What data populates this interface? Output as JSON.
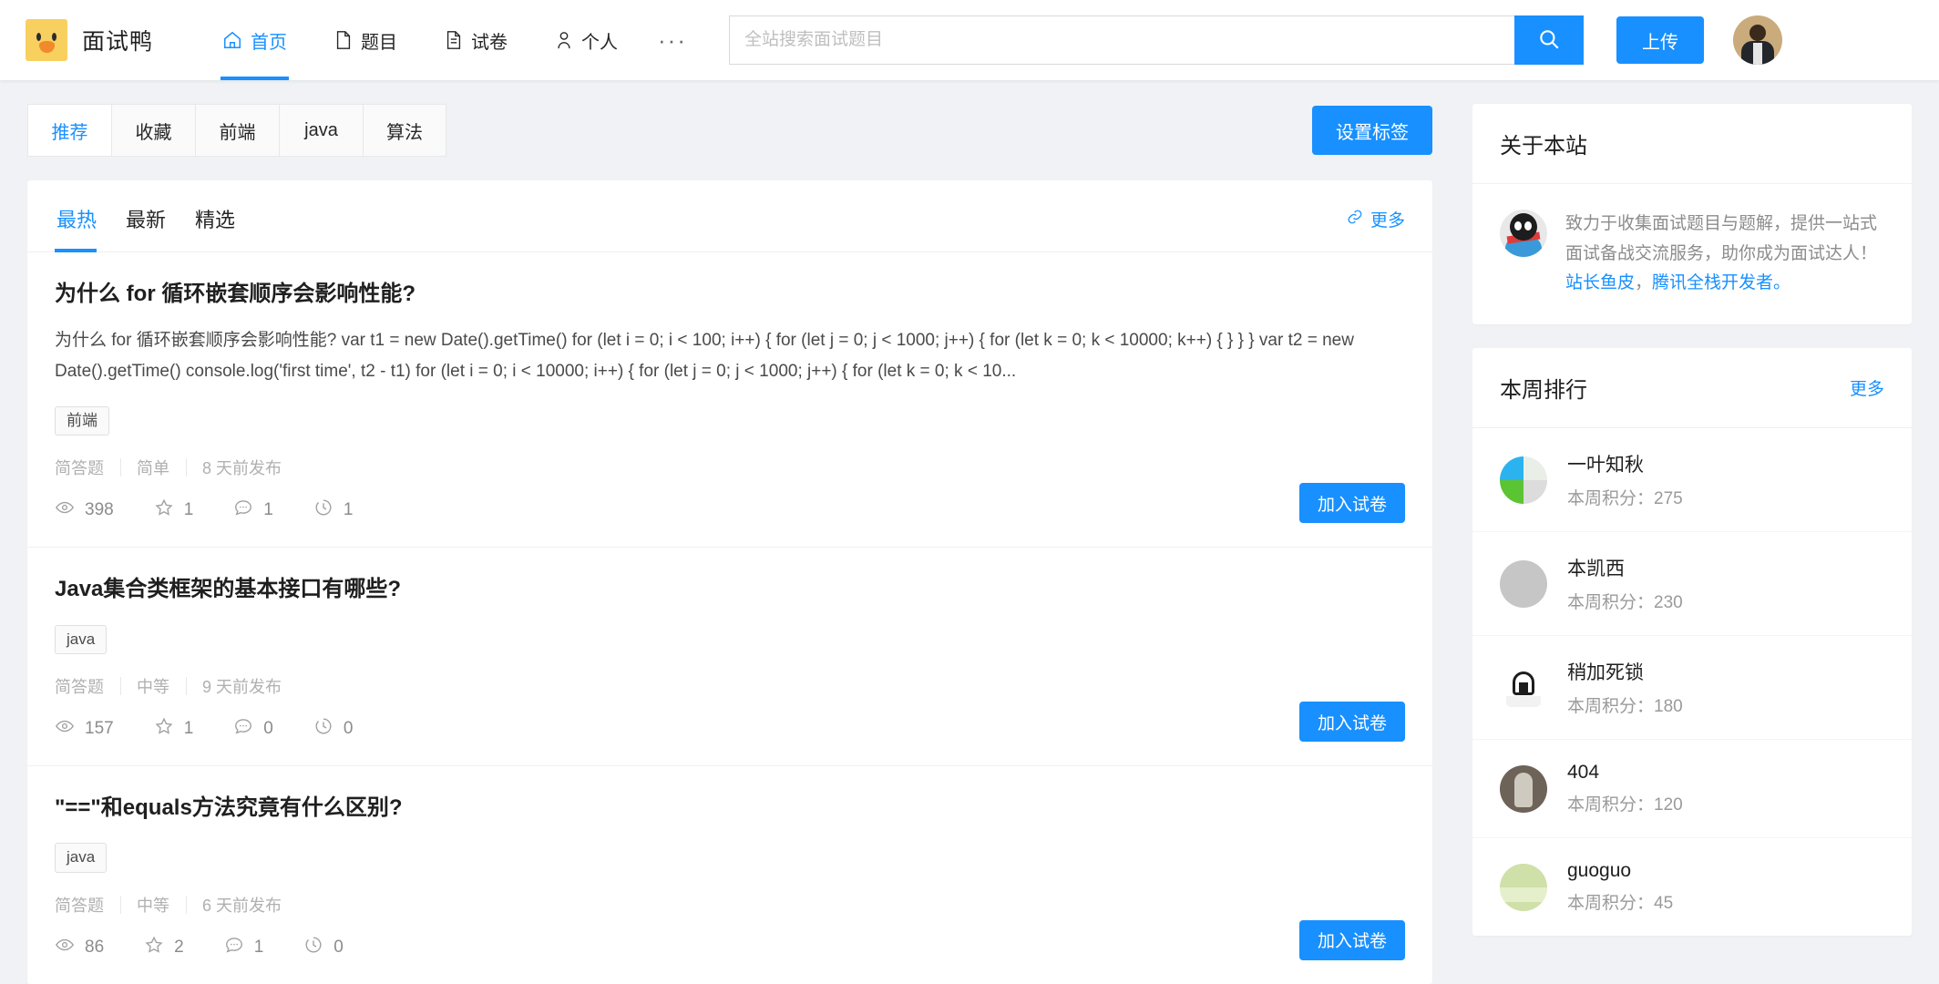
{
  "brand": {
    "name": "面试鸭",
    "logo_icon": "duck-icon"
  },
  "nav": {
    "items": [
      {
        "label": "首页",
        "icon": "home-icon",
        "active": true
      },
      {
        "label": "题目",
        "icon": "file-icon",
        "active": false
      },
      {
        "label": "试卷",
        "icon": "document-icon",
        "active": false
      },
      {
        "label": "个人",
        "icon": "user-icon",
        "active": false
      }
    ],
    "more_label": "···"
  },
  "search": {
    "placeholder": "全站搜索面试题目",
    "value": "",
    "button_icon": "search-icon"
  },
  "header": {
    "upload_label": "上传",
    "avatar_icon": "user-avatar"
  },
  "tagbar": {
    "tags": [
      {
        "label": "推荐",
        "active": true
      },
      {
        "label": "收藏",
        "active": false
      },
      {
        "label": "前端",
        "active": false
      },
      {
        "label": "java",
        "active": false
      },
      {
        "label": "算法",
        "active": false
      }
    ],
    "settings_label": "设置标签"
  },
  "main": {
    "tabs": [
      {
        "label": "最热",
        "active": true
      },
      {
        "label": "最新",
        "active": false
      },
      {
        "label": "精选",
        "active": false
      }
    ],
    "more_label": "更多",
    "more_icon": "link-icon",
    "questions": [
      {
        "title": "为什么 for 循环嵌套顺序会影响性能?",
        "desc": "为什么 for 循环嵌套顺序会影响性能?  var t1 = new Date().getTime() for (let i = 0; i < 100; i++) { for (let j = 0; j < 1000; j++) { for (let k = 0; k < 10000; k++) { } } } var t2 = new Date().getTime() console.log('first time', t2 - t1) for (let i = 0; i < 10000; i++) { for (let j = 0; j < 1000; j++) { for (let k = 0; k < 10...",
        "tags": [
          "前端"
        ],
        "type": "简答题",
        "difficulty": "简单",
        "published": "8 天前发布",
        "views": "398",
        "stars": "1",
        "comments": "1",
        "history": "1",
        "join_label": "加入试卷"
      },
      {
        "title": "Java集合类框架的基本接口有哪些?",
        "desc": "",
        "tags": [
          "java"
        ],
        "type": "简答题",
        "difficulty": "中等",
        "published": "9 天前发布",
        "views": "157",
        "stars": "1",
        "comments": "0",
        "history": "0",
        "join_label": "加入试卷"
      },
      {
        "title": "\"==\"和equals方法究竟有什么区别?",
        "desc": "",
        "tags": [
          "java"
        ],
        "type": "简答题",
        "difficulty": "中等",
        "published": "6 天前发布",
        "views": "86",
        "stars": "2",
        "comments": "1",
        "history": "0",
        "join_label": "加入试卷"
      }
    ]
  },
  "sidebar": {
    "about": {
      "title": "关于本站",
      "avatar_icon": "qq-penguin-icon",
      "text_part1": "致力于收集面试题目与题解，提供一站式面试备战交流服务，助你成为面试达人！",
      "link1": "站长鱼皮",
      "separator": "，",
      "link2": "腾讯全栈开发者。"
    },
    "ranking": {
      "title": "本周排行",
      "more_label": "更多",
      "score_label": "本周积分：",
      "users": [
        {
          "name": "一叶知秋",
          "score": "275",
          "avatar_class": "av-a"
        },
        {
          "name": "本凯西",
          "score": "230",
          "avatar_class": "av-b"
        },
        {
          "name": "稍加死锁",
          "score": "180",
          "avatar_class": "av-c"
        },
        {
          "name": "404",
          "score": "120",
          "avatar_class": "av-d"
        },
        {
          "name": "guoguo",
          "score": "45",
          "avatar_class": "av-e"
        }
      ]
    }
  },
  "colors": {
    "accent": "#1890ff",
    "page_bg": "#f0f2f5",
    "card_bg": "#ffffff",
    "logo_bg": "#f7d060"
  }
}
